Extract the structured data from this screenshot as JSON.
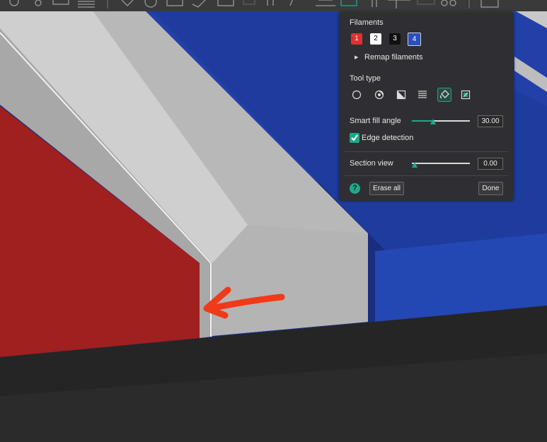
{
  "panel": {
    "filaments_title": "Filaments",
    "filaments": [
      {
        "label": "1",
        "color": "#e03030",
        "text_color": "#ffffff"
      },
      {
        "label": "2",
        "color": "#ffffff",
        "text_color": "#000000"
      },
      {
        "label": "3",
        "color": "#111111",
        "text_color": "#ffffff"
      },
      {
        "label": "4",
        "color": "#2a4fc0",
        "text_color": "#ffffff",
        "selected": true
      }
    ],
    "remap_label": "Remap filaments",
    "tool_type_title": "Tool type",
    "tools": [
      "circle-tool-icon",
      "sphere-tool-icon",
      "triangle-tool-icon",
      "height-range-tool-icon",
      "fill-bucket-tool-icon",
      "gap-fill-tool-icon"
    ],
    "active_tool": "fill-bucket-tool-icon",
    "smart_fill_label": "Smart fill angle",
    "smart_fill_value": "30.00",
    "smart_fill_fraction": 0.36,
    "edge_detection_label": "Edge detection",
    "edge_detection_checked": true,
    "section_view_label": "Section view",
    "section_view_value": "0.00",
    "section_view_fraction": 0.0,
    "erase_all_label": "Erase all",
    "done_label": "Done"
  },
  "colors": {
    "accent": "#1fa88a",
    "panel_bg": "#2f2f33",
    "model_red": "#a01f1f",
    "model_blue": "#1e3b9c",
    "model_grey": "#b4b4b4",
    "annotation_arrow": "#f03a1a"
  }
}
